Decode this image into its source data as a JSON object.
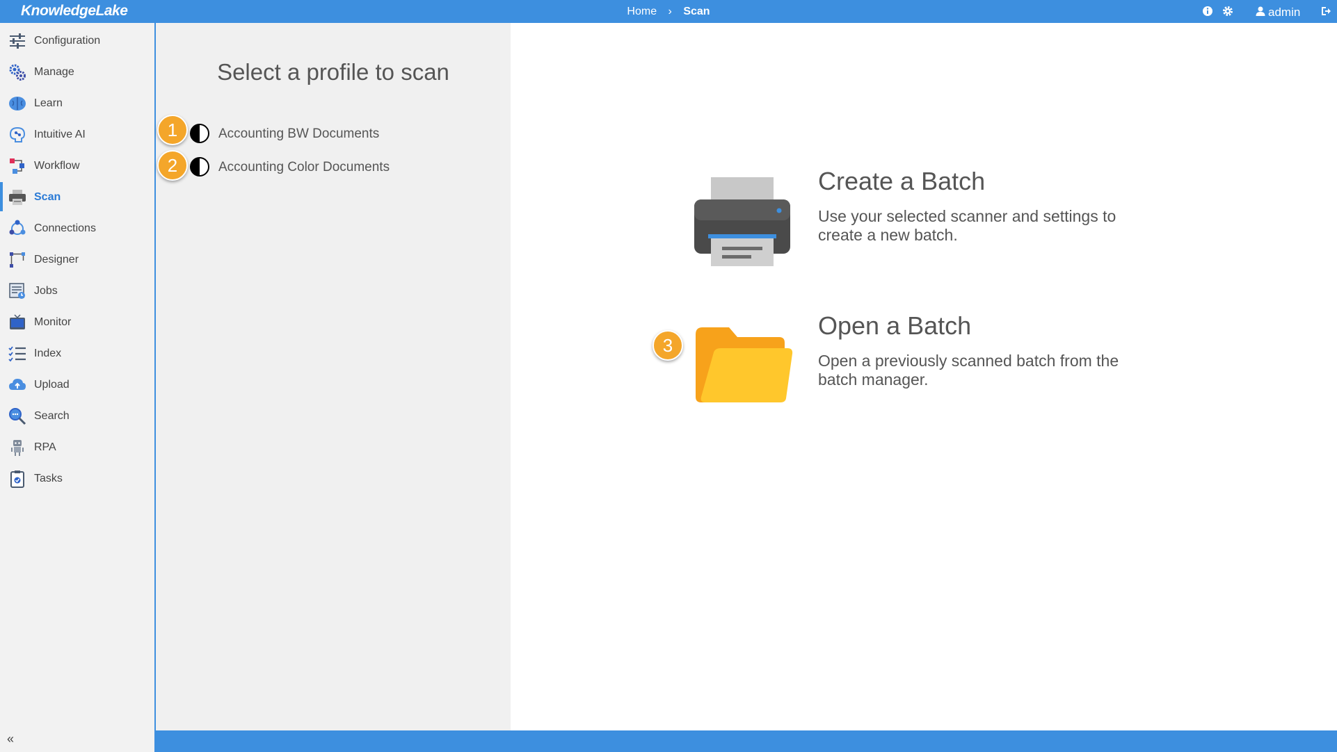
{
  "app": {
    "logo": "KnowledgeLake"
  },
  "breadcrumb": {
    "home": "Home",
    "separator": "›",
    "current": "Scan"
  },
  "header": {
    "user": "admin",
    "icons": [
      "info-icon",
      "gear-icon",
      "user-icon",
      "logout-icon"
    ]
  },
  "sidebar": {
    "items": [
      {
        "label": "Configuration",
        "icon": "sliders-icon"
      },
      {
        "label": "Manage",
        "icon": "gears-icon"
      },
      {
        "label": "Learn",
        "icon": "brain-icon"
      },
      {
        "label": "Intuitive AI",
        "icon": "ai-head-icon"
      },
      {
        "label": "Workflow",
        "icon": "workflow-icon"
      },
      {
        "label": "Scan",
        "icon": "printer-icon",
        "active": true
      },
      {
        "label": "Connections",
        "icon": "connections-icon"
      },
      {
        "label": "Designer",
        "icon": "designer-icon"
      },
      {
        "label": "Jobs",
        "icon": "jobs-icon"
      },
      {
        "label": "Monitor",
        "icon": "monitor-icon"
      },
      {
        "label": "Index",
        "icon": "checklist-icon"
      },
      {
        "label": "Upload",
        "icon": "cloud-upload-icon"
      },
      {
        "label": "Search",
        "icon": "search-icon"
      },
      {
        "label": "RPA",
        "icon": "robot-icon"
      },
      {
        "label": "Tasks",
        "icon": "clipboard-icon"
      }
    ],
    "collapse": "«"
  },
  "profiles": {
    "title": "Select a profile to scan",
    "items": [
      {
        "label": "Accounting BW Documents",
        "badge": "1"
      },
      {
        "label": "Accounting Color Documents",
        "badge": "2"
      }
    ]
  },
  "actions": {
    "create": {
      "title": "Create a Batch",
      "description": "Use your selected scanner and settings to create a new batch."
    },
    "open": {
      "title": "Open a Batch",
      "description": "Open a previously scanned batch from the batch manager.",
      "badge": "3"
    }
  },
  "colors": {
    "accent": "#3d8fdf",
    "badge": "#f4a62a",
    "folder": "#ffc72c"
  }
}
